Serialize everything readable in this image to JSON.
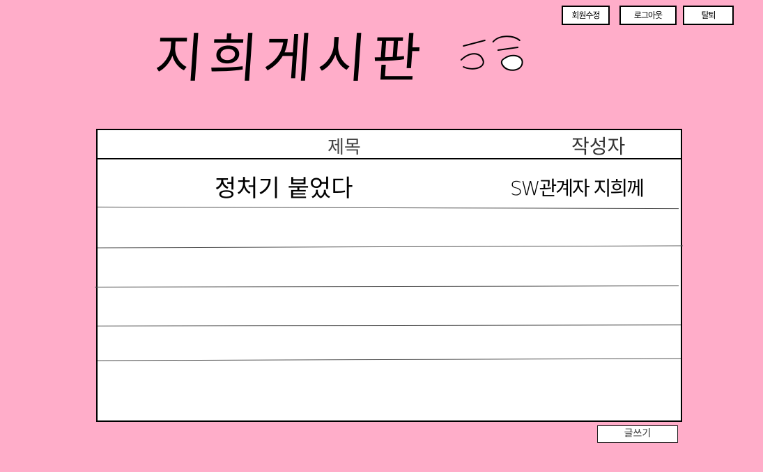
{
  "header": {
    "buttons": {
      "edit_profile": "회원수정",
      "logout": "로그아웃",
      "withdraw": "탈퇴"
    },
    "title": "지희게시판"
  },
  "board": {
    "columns": {
      "title": "제목",
      "author": "작성자"
    },
    "rows": [
      {
        "title": "정처기 붙었다",
        "author": "SW관계자 지희께"
      }
    ]
  },
  "footer": {
    "write_button": "글쓰기"
  },
  "colors": {
    "background": "#ffadc9",
    "panel": "#ffffff",
    "border": "#000000"
  }
}
